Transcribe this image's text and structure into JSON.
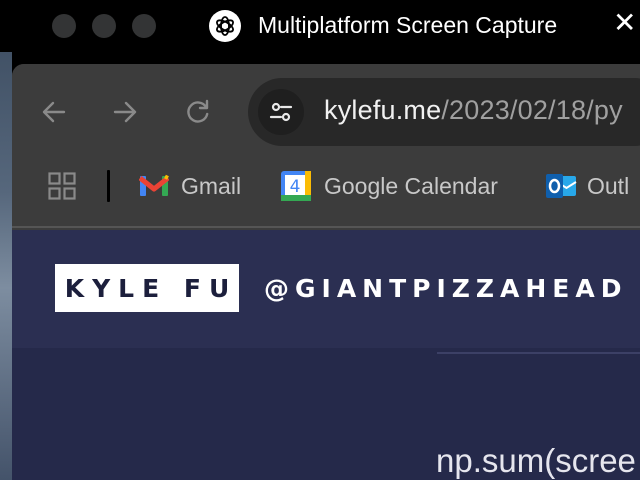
{
  "window": {
    "title": "Multiplatform Screen Capture",
    "close_glyph": "✕",
    "app_icon": "chatgpt-logo-icon"
  },
  "browser": {
    "url_host": "kylefu.me",
    "url_path": "/2023/02/18/py",
    "bookmarks": [
      {
        "label": "Gmail",
        "icon": "gmail-icon"
      },
      {
        "label": "Google Calendar",
        "icon": "google-calendar-icon",
        "badge": "4"
      },
      {
        "label": "Outl",
        "icon": "outlook-icon"
      }
    ]
  },
  "page": {
    "logo": "KYLE FU",
    "handle": "@GIANTPIZZAHEAD",
    "code_text": "np.sum(scree"
  },
  "colors": {
    "titlebar_bg": "#000000",
    "browser_chrome": "#3c3c3c",
    "omnibox_bg": "#282828",
    "page_bg": "#25294a",
    "header_bg": "#2b2f52"
  }
}
